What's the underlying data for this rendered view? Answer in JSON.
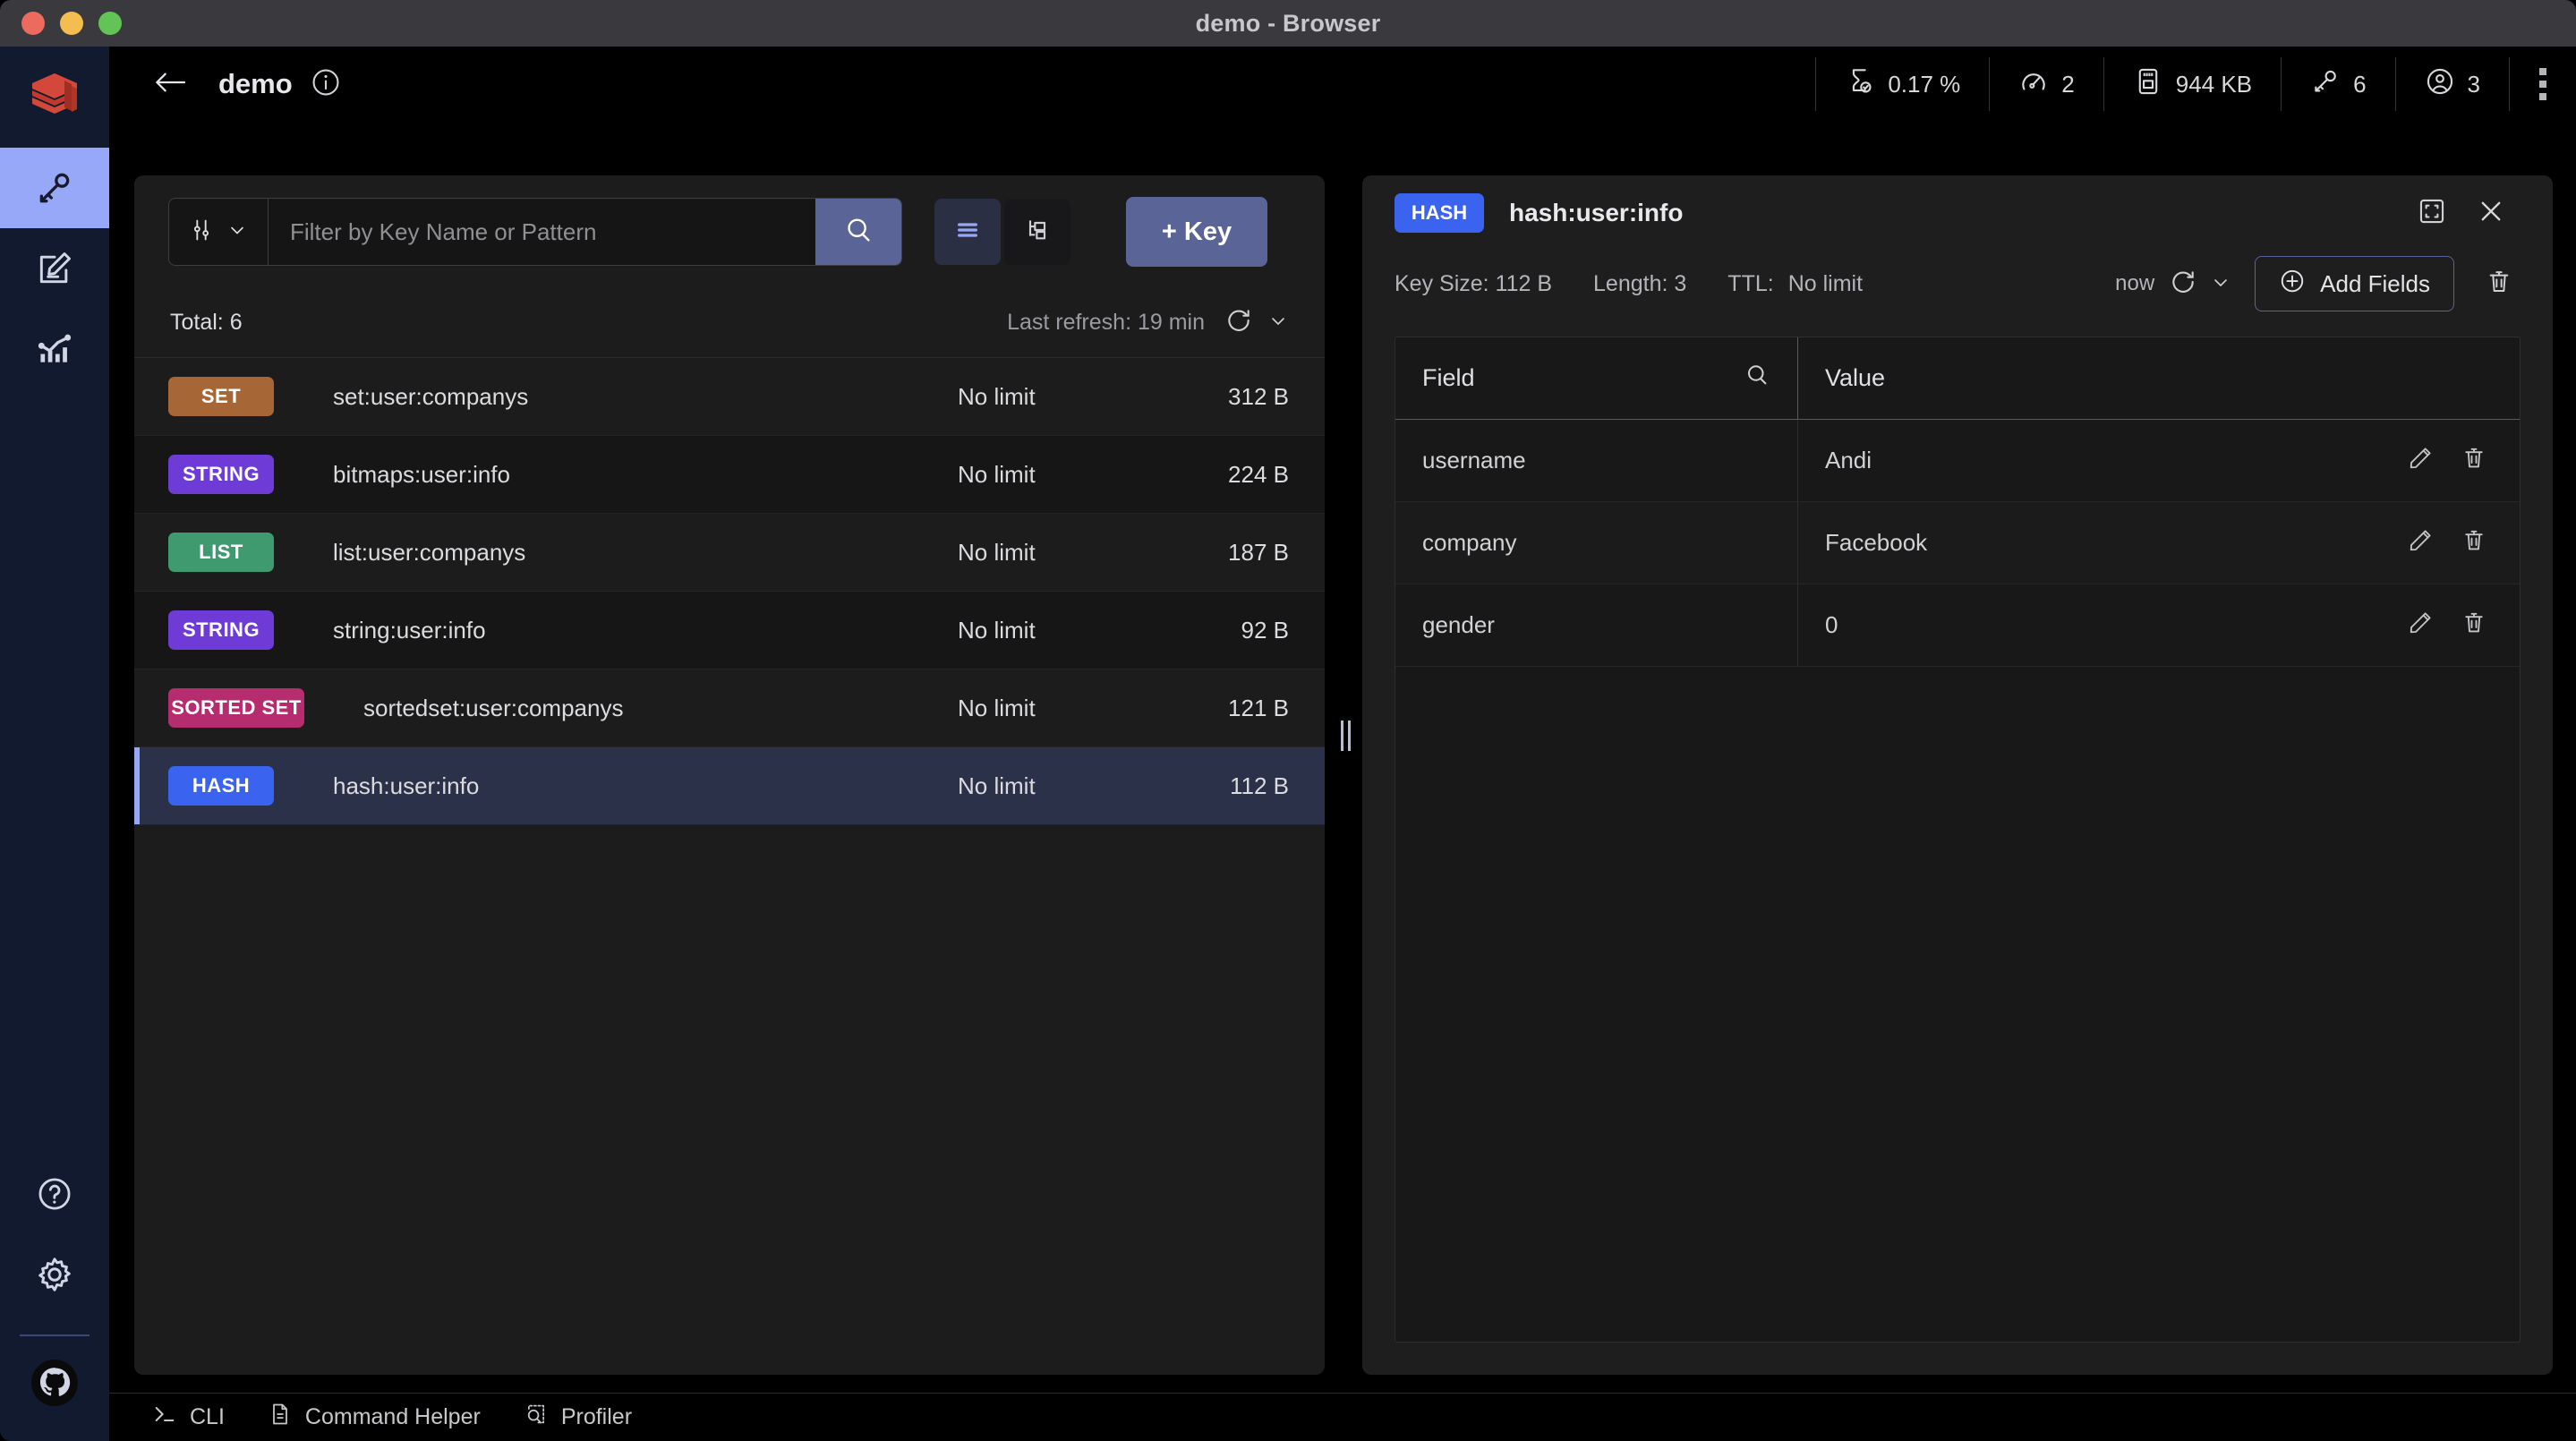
{
  "window": {
    "title": "demo - Browser",
    "traffic_lights": [
      "close",
      "minimize",
      "maximize"
    ]
  },
  "sidebar": {
    "logo": "redis-logo",
    "items": [
      {
        "id": "browser",
        "icon": "key-icon",
        "active": true
      },
      {
        "id": "workbench",
        "icon": "edit-document-icon",
        "active": false
      },
      {
        "id": "analytics",
        "icon": "analytics-chart-icon",
        "active": false
      }
    ],
    "bottom_items": [
      {
        "id": "help",
        "icon": "help-circle-icon"
      },
      {
        "id": "settings",
        "icon": "gear-icon"
      },
      {
        "id": "github",
        "icon": "github-icon"
      }
    ]
  },
  "header": {
    "back_icon": "arrow-left-icon",
    "database_name": "demo",
    "info_icon": "info-circle-icon",
    "metrics": [
      {
        "icon": "cpu-hourglass-icon",
        "value": "0.17 %"
      },
      {
        "icon": "speedometer-icon",
        "value": "2"
      },
      {
        "icon": "memory-card-icon",
        "value": "944 KB"
      },
      {
        "icon": "key-icon",
        "value": "6"
      },
      {
        "icon": "user-circle-icon",
        "value": "3"
      }
    ],
    "more_icon": "vertical-dots-icon"
  },
  "keys_panel": {
    "filter_icon": "sliders-icon",
    "filter_chevron": "chevron-down-icon",
    "search": {
      "placeholder": "Filter by Key Name or Pattern",
      "value": "",
      "button_icon": "search-icon"
    },
    "view_toggle": [
      {
        "id": "list-view",
        "icon": "list-view-icon",
        "active": true
      },
      {
        "id": "tree-view",
        "icon": "tree-view-icon",
        "active": false
      }
    ],
    "add_key_label": "+ Key",
    "total_label": "Total: 6",
    "last_refresh_label": "Last refresh: 19 min",
    "refresh_icon": "refresh-icon",
    "refresh_chevron": "chevron-down-icon",
    "rows": [
      {
        "type": "SET",
        "color": "#a66636",
        "name": "set:user:companys",
        "ttl": "No limit",
        "size": "312 B",
        "selected": false
      },
      {
        "type": "STRING",
        "color": "#6f3bd6",
        "name": "bitmaps:user:info",
        "ttl": "No limit",
        "size": "224 B",
        "selected": false
      },
      {
        "type": "LIST",
        "color": "#3f9a70",
        "name": "list:user:companys",
        "ttl": "No limit",
        "size": "187 B",
        "selected": false
      },
      {
        "type": "STRING",
        "color": "#6f3bd6",
        "name": "string:user:info",
        "ttl": "No limit",
        "size": "92 B",
        "selected": false
      },
      {
        "type": "SORTED SET",
        "color": "#b52d6e",
        "name": "sortedset:user:companys",
        "ttl": "No limit",
        "size": "121 B",
        "selected": false
      },
      {
        "type": "HASH",
        "color": "#3a64f0",
        "name": "hash:user:info",
        "ttl": "No limit",
        "size": "112 B",
        "selected": true
      }
    ]
  },
  "drag_handle_icon": "panel-resize-handle",
  "details_panel": {
    "badge": "HASH",
    "badge_color": "#3a64f0",
    "key_name": "hash:user:info",
    "expand_icon": "fullscreen-icon",
    "close_icon": "close-icon",
    "key_size_label": "Key Size: 112 B",
    "length_label": "Length: 3",
    "ttl_label": "TTL:",
    "ttl_value": "No limit",
    "now_label": "now",
    "refresh_icon": "refresh-icon",
    "refresh_chevron": "chevron-down-icon",
    "add_fields_label": "Add Fields",
    "add_fields_icon": "plus-circle-icon",
    "delete_key_icon": "trash-icon",
    "table": {
      "columns": [
        "Field",
        "Value"
      ],
      "field_search_icon": "search-icon",
      "rows": [
        {
          "field": "username",
          "value": "Andi",
          "edit_icon": "pencil-icon",
          "delete_icon": "trash-icon"
        },
        {
          "field": "company",
          "value": "Facebook",
          "edit_icon": "pencil-icon",
          "delete_icon": "trash-icon"
        },
        {
          "field": "gender",
          "value": "0",
          "edit_icon": "pencil-icon",
          "delete_icon": "trash-icon"
        }
      ]
    }
  },
  "bottom_bar": {
    "items": [
      {
        "label": "CLI",
        "icon": "terminal-icon"
      },
      {
        "label": "Command Helper",
        "icon": "document-icon"
      },
      {
        "label": "Profiler",
        "icon": "profiler-search-icon"
      }
    ]
  },
  "colors": {
    "accent": "#5a6496",
    "accent_light": "#98a8f8",
    "rail_bg": "#111a2e",
    "panel_bg": "#1c1c1c",
    "selected_row": "#2b3149"
  }
}
